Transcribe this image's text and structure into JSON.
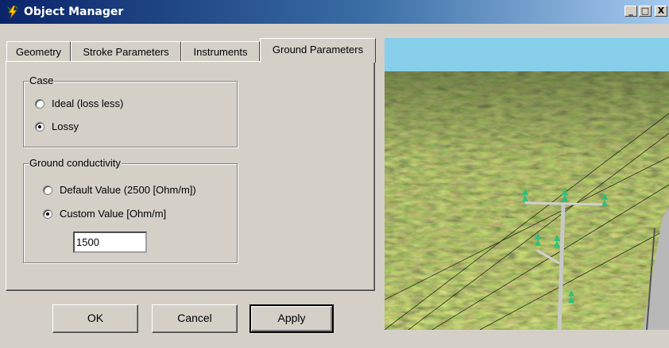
{
  "window": {
    "title": "Object Manager",
    "minimize": "_",
    "maximize": "□",
    "close": "X"
  },
  "tabs": [
    {
      "label": "Geometry",
      "active": false
    },
    {
      "label": "Stroke Parameters",
      "active": false
    },
    {
      "label": "Instruments",
      "active": false
    },
    {
      "label": "Ground Parameters",
      "active": true
    }
  ],
  "case_group": {
    "title": "Case",
    "options": [
      {
        "label": "Ideal  (loss less)",
        "checked": false
      },
      {
        "label": "Lossy",
        "checked": true
      }
    ]
  },
  "conductivity_group": {
    "title": "Ground conductivity",
    "options": [
      {
        "label": "Default Value  (2500  [Ohm/m])",
        "checked": false
      },
      {
        "label": "Custom Value  [Ohm/m]",
        "checked": true
      }
    ],
    "custom_value": "1500"
  },
  "buttons": {
    "ok": "OK",
    "cancel": "Cancel",
    "apply": "Apply"
  },
  "colors": {
    "title_bar_start": "#0a246a",
    "title_bar_end": "#a6caf0",
    "dialog_face": "#d4d0c8",
    "ground": "#4a5a2c",
    "sky": "#87ceeb",
    "insulator": "#2fc07a"
  },
  "icons": {
    "app": "lightning-icon"
  }
}
